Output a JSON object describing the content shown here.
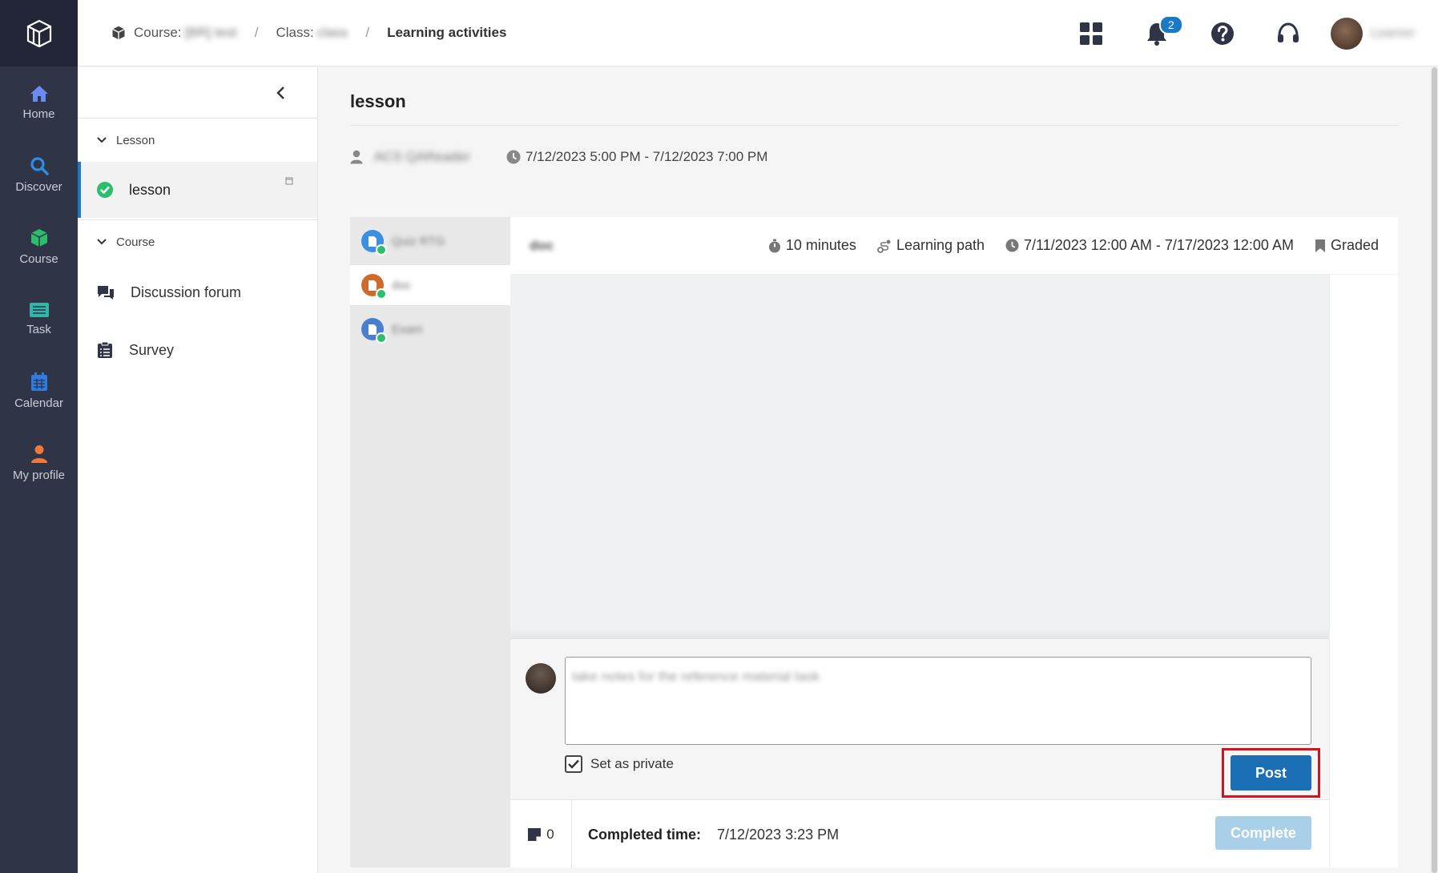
{
  "nav": {
    "items": [
      {
        "label": "Home",
        "icon": "home-icon",
        "color": "#6a8cf0"
      },
      {
        "label": "Discover",
        "icon": "search-icon",
        "color": "#2f8de0"
      },
      {
        "label": "Course",
        "icon": "cube-icon",
        "color": "#2dbe6c"
      },
      {
        "label": "Task",
        "icon": "task-icon",
        "color": "#33b5a8"
      },
      {
        "label": "Calendar",
        "icon": "calendar-icon",
        "color": "#2f7be0"
      },
      {
        "label": "My profile",
        "icon": "user-icon",
        "color": "#f07a3c"
      }
    ]
  },
  "breadcrumb": {
    "course_label": "Course:",
    "course_value": "[BR] test",
    "class_label": "Class:",
    "class_value": "class",
    "separator": "/",
    "current": "Learning activities"
  },
  "header": {
    "notification_count": "2",
    "user_name": "Learner"
  },
  "sidebar": {
    "section_lesson": "Lesson",
    "lesson_item": "lesson",
    "section_course": "Course",
    "items": [
      {
        "label": "Discussion forum",
        "icon": "forum-icon"
      },
      {
        "label": "Survey",
        "icon": "clipboard-icon"
      }
    ]
  },
  "main": {
    "title": "lesson",
    "instructor": "ACS QAReader",
    "schedule": "7/12/2023 5:00 PM - 7/12/2023 7:00 PM"
  },
  "activities": {
    "tabs": [
      {
        "label": "Quiz RTG",
        "color": "#3b8fe0"
      },
      {
        "label": "doc",
        "color": "#d06a2a"
      },
      {
        "label": "Exam",
        "color": "#4a7fd0"
      }
    ],
    "active_index": 1
  },
  "activity": {
    "title": "doc",
    "duration": "10 minutes",
    "type": "Learning path",
    "window": "7/11/2023 12:00 AM - 7/17/2023 12:00 AM",
    "grading": "Graded"
  },
  "note": {
    "placeholder": "take notes for the reference material task",
    "private_label": "Set as private",
    "private_checked": true,
    "post_label": "Post"
  },
  "footer": {
    "note_count": "0",
    "completed_label": "Completed time:",
    "completed_value": "7/12/2023 3:23 PM",
    "complete_label": "Complete"
  }
}
